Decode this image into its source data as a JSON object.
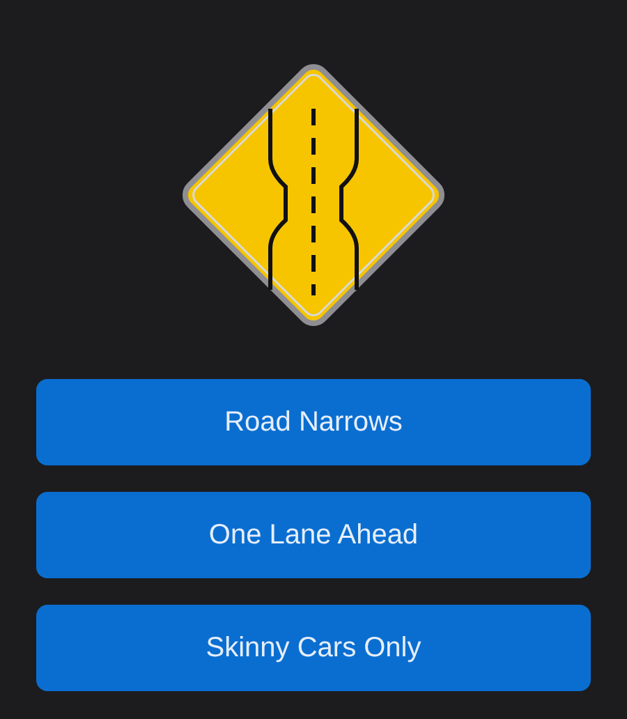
{
  "answers": [
    {
      "label": "Road Narrows"
    },
    {
      "label": "One Lane Ahead"
    },
    {
      "label": "Skinny Cars Only"
    }
  ]
}
